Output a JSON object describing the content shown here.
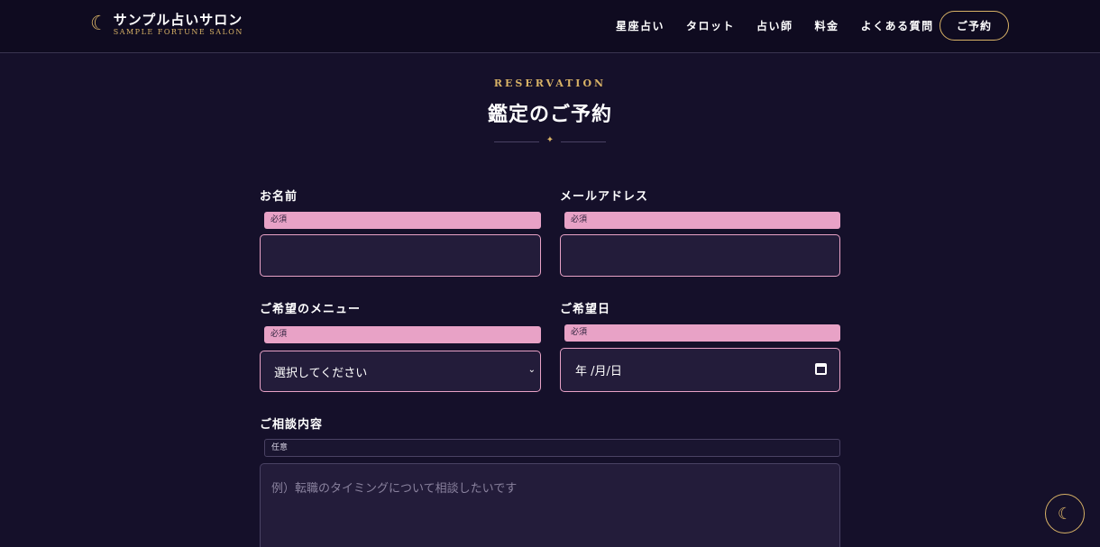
{
  "header": {
    "logo_icon": "crescent-moon-icon",
    "logo_title": "サンプル占いサロン",
    "logo_subtitle": "SAMPLE FORTUNE SALON",
    "nav": [
      "星座占い",
      "タロット",
      "占い師",
      "料金",
      "よくある質問"
    ],
    "reserve_button": "ご予約"
  },
  "section": {
    "eyebrow": "RESERVATION",
    "title": "鑑定のご予約",
    "divider_icon": "sparkle-icon"
  },
  "form": {
    "name": {
      "label": "お名前",
      "badge": "必須",
      "value": ""
    },
    "email": {
      "label": "メールアドレス",
      "badge": "必須",
      "value": ""
    },
    "menu": {
      "label": "ご希望のメニュー",
      "badge": "必須",
      "selected": "選択してください"
    },
    "date": {
      "label": "ご希望日",
      "badge": "必須",
      "placeholder": "年 /月/日"
    },
    "message": {
      "label": "ご相談内容",
      "badge": "任意",
      "placeholder": "例）転職のタイミングについて相談したいです"
    }
  },
  "floating_button": {
    "icon": "crescent-moon-icon"
  },
  "colors": {
    "background": "#15102a",
    "header": "#0f0b20",
    "gold": "#d8b266",
    "pink": "#e8a2c6",
    "field": "#231c3a"
  }
}
